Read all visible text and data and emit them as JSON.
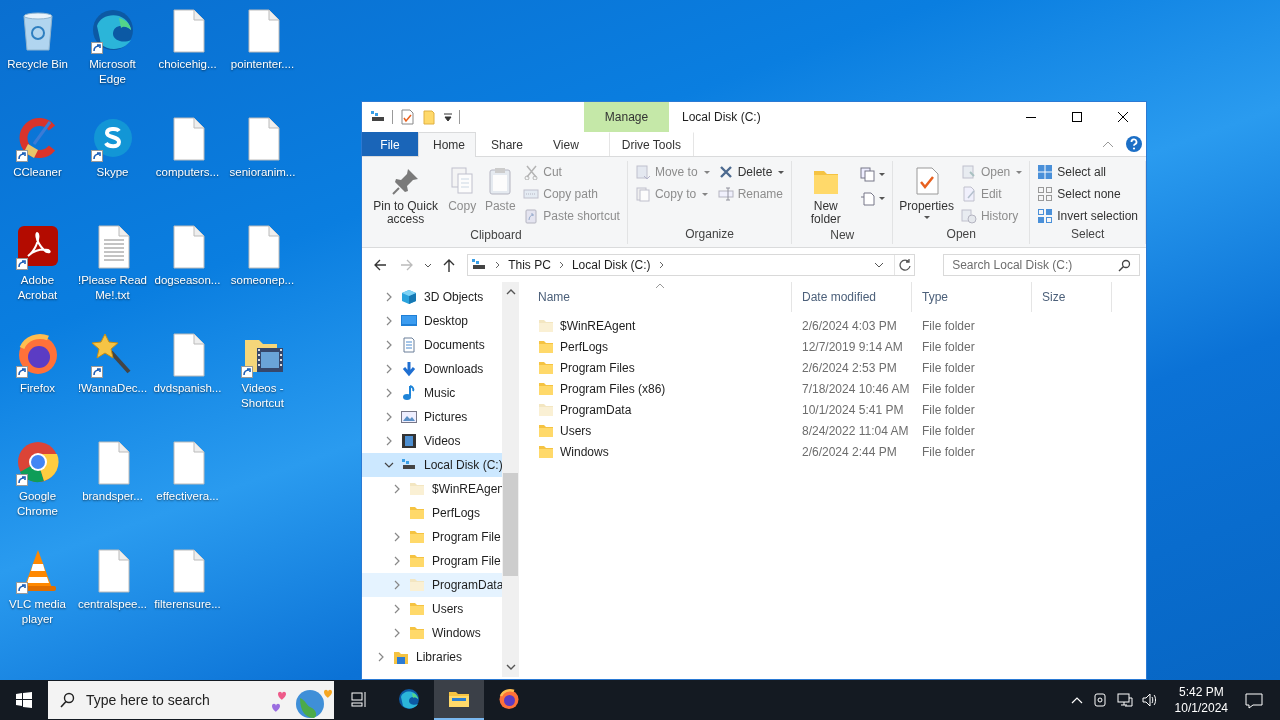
{
  "desktop_icons": [
    {
      "label": "Recycle Bin",
      "kind": "recycle",
      "shortcut": false
    },
    {
      "label": "CCleaner",
      "kind": "ccleaner",
      "shortcut": true
    },
    {
      "label": "Adobe Acrobat",
      "kind": "acrobat",
      "shortcut": true
    },
    {
      "label": "Firefox",
      "kind": "firefox",
      "shortcut": true
    },
    {
      "label": "Google Chrome",
      "kind": "chrome",
      "shortcut": true
    },
    {
      "label": "VLC media player",
      "kind": "vlc",
      "shortcut": true
    },
    {
      "label": "Microsoft Edge",
      "kind": "edge",
      "shortcut": true
    },
    {
      "label": "Skype",
      "kind": "skype",
      "shortcut": true
    },
    {
      "label": "!Please Read Me!.txt",
      "kind": "textfile",
      "shortcut": false
    },
    {
      "label": "!WannaDec...",
      "kind": "wand",
      "shortcut": true
    },
    {
      "label": "brandsper...",
      "kind": "file",
      "shortcut": false
    },
    {
      "label": "centralspee...",
      "kind": "file",
      "shortcut": false
    },
    {
      "label": "choicehig...",
      "kind": "file",
      "shortcut": false
    },
    {
      "label": "computers...",
      "kind": "file",
      "shortcut": false
    },
    {
      "label": "dogseason...",
      "kind": "file",
      "shortcut": false
    },
    {
      "label": "dvdspanish...",
      "kind": "file",
      "shortcut": false
    },
    {
      "label": "effectivera...",
      "kind": "file",
      "shortcut": false
    },
    {
      "label": "filterensure...",
      "kind": "file",
      "shortcut": false
    },
    {
      "label": "pointenter....",
      "kind": "file",
      "shortcut": false
    },
    {
      "label": "senioranim...",
      "kind": "file",
      "shortcut": false
    },
    {
      "label": "someonep...",
      "kind": "file",
      "shortcut": false
    },
    {
      "label": "Videos - Shortcut",
      "kind": "videos",
      "shortcut": true
    }
  ],
  "explorer": {
    "title": "Local Disk (C:)",
    "context_group": "Manage",
    "tabs": [
      {
        "label": "File",
        "kind": "file",
        "selected": false
      },
      {
        "label": "Home",
        "kind": "normal",
        "selected": true
      },
      {
        "label": "Share",
        "kind": "normal",
        "selected": false
      },
      {
        "label": "View",
        "kind": "normal",
        "selected": false
      },
      {
        "label": "Drive Tools",
        "kind": "context",
        "selected": false
      }
    ],
    "ribbon_groups": [
      {
        "title": "Clipboard",
        "columns": [
          {
            "kind": "large",
            "items": [
              {
                "label": "Pin to Quick access",
                "kind": "pin",
                "disabled": false,
                "dropdown": false
              }
            ]
          },
          {
            "kind": "large",
            "items": [
              {
                "label": "Copy",
                "kind": "copy",
                "disabled": true,
                "dropdown": false
              }
            ]
          },
          {
            "kind": "large",
            "items": [
              {
                "label": "Paste",
                "kind": "paste",
                "disabled": true,
                "dropdown": false
              }
            ]
          },
          {
            "kind": "small",
            "items": [
              {
                "label": "Cut",
                "kind": "cut",
                "disabled": true,
                "dropdown": false
              },
              {
                "label": "Copy path",
                "kind": "copy-path",
                "disabled": true,
                "dropdown": false
              },
              {
                "label": "Paste shortcut",
                "kind": "paste-shortcut",
                "disabled": true,
                "dropdown": false
              }
            ]
          }
        ]
      },
      {
        "title": "Organize",
        "columns": [
          {
            "kind": "small",
            "items": [
              {
                "label": "Move to",
                "kind": "move-to",
                "disabled": true,
                "dropdown": true
              },
              {
                "label": "Copy to",
                "kind": "copy-to",
                "disabled": true,
                "dropdown": true
              }
            ]
          },
          {
            "kind": "small",
            "items": [
              {
                "label": "Delete",
                "kind": "delete",
                "disabled": false,
                "dropdown": true
              },
              {
                "label": "Rename",
                "kind": "rename",
                "disabled": true,
                "dropdown": false
              }
            ]
          }
        ]
      },
      {
        "title": "New",
        "columns": [
          {
            "kind": "large",
            "items": [
              {
                "label": "New folder",
                "kind": "new-folder",
                "disabled": false,
                "dropdown": false
              }
            ]
          },
          {
            "kind": "icons",
            "items": [
              {
                "kind": "new-item",
                "disabled": false,
                "dropdown": true
              },
              {
                "kind": "easy-access",
                "disabled": false,
                "dropdown": true
              }
            ]
          }
        ]
      },
      {
        "title": "Open",
        "columns": [
          {
            "kind": "large",
            "items": [
              {
                "label": "Properties",
                "kind": "properties",
                "disabled": false,
                "dropdown": true
              }
            ]
          },
          {
            "kind": "small",
            "items": [
              {
                "label": "Open",
                "kind": "open",
                "disabled": true,
                "dropdown": true
              },
              {
                "label": "Edit",
                "kind": "edit",
                "disabled": true,
                "dropdown": false
              },
              {
                "label": "History",
                "kind": "history",
                "disabled": true,
                "dropdown": false
              }
            ]
          }
        ]
      },
      {
        "title": "Select",
        "columns": [
          {
            "kind": "small",
            "items": [
              {
                "label": "Select all",
                "kind": "select-all",
                "disabled": false,
                "dropdown": false
              },
              {
                "label": "Select none",
                "kind": "select-none",
                "disabled": false,
                "dropdown": false
              },
              {
                "label": "Invert selection",
                "kind": "invert-selection",
                "disabled": false,
                "dropdown": false
              }
            ]
          }
        ]
      }
    ],
    "breadcrumbs": [
      "This PC",
      "Local Disk (C:)"
    ],
    "search": {
      "placeholder": "Search Local Disk (C:)"
    },
    "nav_tree": [
      {
        "children": [
          {
            "label": "3D Objects",
            "kind": "cube",
            "expanded": false,
            "has_children": true,
            "selected": false,
            "highlighted": false
          },
          {
            "label": "Desktop",
            "kind": "desktop",
            "expanded": false,
            "has_children": true,
            "selected": false,
            "highlighted": false
          },
          {
            "label": "Documents",
            "kind": "documents",
            "expanded": false,
            "has_children": true,
            "selected": false,
            "highlighted": false
          },
          {
            "label": "Downloads",
            "kind": "downloads",
            "expanded": false,
            "has_children": true,
            "selected": false,
            "highlighted": false
          },
          {
            "label": "Music",
            "kind": "music",
            "expanded": false,
            "has_children": true,
            "selected": false,
            "highlighted": false
          },
          {
            "label": "Pictures",
            "kind": "pictures",
            "expanded": false,
            "has_children": true,
            "selected": false,
            "highlighted": false
          },
          {
            "label": "Videos",
            "kind": "videos",
            "expanded": false,
            "has_children": true,
            "selected": false,
            "highlighted": false
          },
          {
            "label": "Local Disk (C:)",
            "kind": "drive",
            "expanded": true,
            "has_children": true,
            "selected": true,
            "highlighted": false,
            "children": [
              {
                "label": "$WinREAgen",
                "kind": "hidden-folder",
                "expanded": false,
                "has_children": true,
                "selected": false,
                "highlighted": false
              },
              {
                "label": "PerfLogs",
                "kind": "folder",
                "has_children": false,
                "selected": false,
                "highlighted": false
              },
              {
                "label": "Program File",
                "kind": "folder",
                "expanded": false,
                "has_children": true,
                "selected": false,
                "highlighted": false
              },
              {
                "label": "Program File",
                "kind": "folder",
                "expanded": false,
                "has_children": true,
                "selected": false,
                "highlighted": false
              },
              {
                "label": "ProgramData",
                "kind": "hidden-folder",
                "expanded": false,
                "has_children": true,
                "selected": false,
                "highlighted": true
              },
              {
                "label": "Users",
                "kind": "folder",
                "expanded": false,
                "has_children": true,
                "selected": false,
                "highlighted": false
              },
              {
                "label": "Windows",
                "kind": "folder",
                "expanded": false,
                "has_children": true,
                "selected": false,
                "highlighted": false
              }
            ]
          }
        ]
      },
      {
        "label": "Libraries",
        "kind": "libraries",
        "expanded": false,
        "has_children": true,
        "selected": false,
        "highlighted": false
      }
    ],
    "columns": [
      {
        "label": "Name",
        "sorted": true
      },
      {
        "label": "Date modified",
        "sorted": false
      },
      {
        "label": "Type",
        "sorted": false
      },
      {
        "label": "Size",
        "sorted": false
      }
    ],
    "rows": [
      {
        "name": "$WinREAgent",
        "date": "2/6/2024 4:03 PM",
        "type": "File folder",
        "hidden": true
      },
      {
        "name": "PerfLogs",
        "date": "12/7/2019 9:14 AM",
        "type": "File folder",
        "hidden": false
      },
      {
        "name": "Program Files",
        "date": "2/6/2024 2:53 PM",
        "type": "File folder",
        "hidden": false
      },
      {
        "name": "Program Files (x86)",
        "date": "7/18/2024 10:46 AM",
        "type": "File folder",
        "hidden": false
      },
      {
        "name": "ProgramData",
        "date": "10/1/2024 5:41 PM",
        "type": "File folder",
        "hidden": true
      },
      {
        "name": "Users",
        "date": "8/24/2022 11:04 AM",
        "type": "File folder",
        "hidden": false
      },
      {
        "name": "Windows",
        "date": "2/6/2024 2:44 PM",
        "type": "File folder",
        "hidden": false
      }
    ]
  },
  "taskbar": {
    "search_placeholder": "Type here to search",
    "apps": [
      {
        "kind": "taskview",
        "active": false
      },
      {
        "kind": "edge",
        "active": false
      },
      {
        "kind": "explorer",
        "active": true
      },
      {
        "kind": "firefox",
        "active": false
      }
    ],
    "time": "5:42 PM",
    "date": "10/1/2024"
  }
}
